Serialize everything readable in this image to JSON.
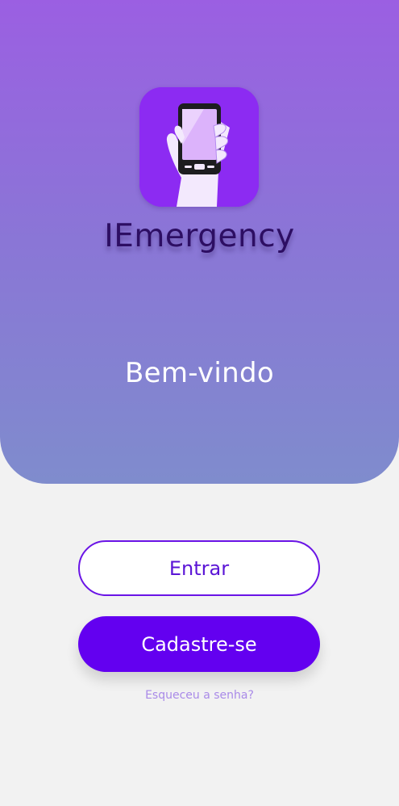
{
  "app": {
    "name": "IEmergency",
    "logo_icon": "hand-holding-phone-icon"
  },
  "hero": {
    "welcome_text": "Bem-vindo"
  },
  "actions": {
    "login_label": "Entrar",
    "signup_label": "Cadastre-se",
    "forgot_password_label": "Esqueceu a senha?"
  },
  "colors": {
    "hero_gradient_top": "#9b5fe2",
    "hero_gradient_bottom": "#7f8ccd",
    "primary": "#6300f0",
    "logo_background": "#8c2bf2",
    "app_name": "#2d0e63",
    "forgot_link": "#a98ae8",
    "page_background": "#f2f2f2"
  }
}
